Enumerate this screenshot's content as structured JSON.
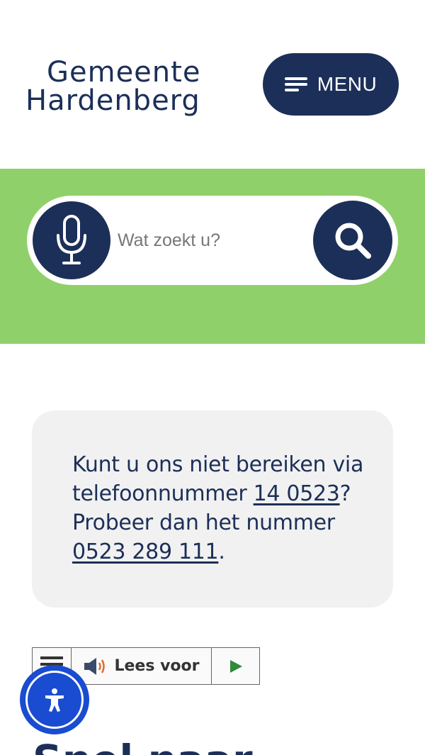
{
  "header": {
    "logo": {
      "line1": "Gemeente",
      "line2": "Hardenberg",
      "accent_color": "#8fd06b"
    },
    "menu_label": "MENU"
  },
  "search": {
    "placeholder": "Wat zoekt u?",
    "mic_icon": "microphone-icon",
    "search_icon": "magnifier-icon"
  },
  "notice": {
    "text_before": "Kunt u ons niet bereiken via telefoonnummer ",
    "link1": "14 0523",
    "text_mid": "? Probeer dan het nummer ",
    "link2": "0523 289 111",
    "text_end": "."
  },
  "readspeaker": {
    "label": "Lees voor",
    "menu_icon": "hamburger-icon",
    "speaker_icon": "speaker-icon",
    "play_icon": "play-icon"
  },
  "accessibility": {
    "icon": "accessibility-person-icon"
  },
  "heading": "Snel naar",
  "colors": {
    "navy": "#1c2f58",
    "green": "#8fd06b",
    "card": "#f1f1f1",
    "a11y_blue": "#1a4cd1"
  }
}
